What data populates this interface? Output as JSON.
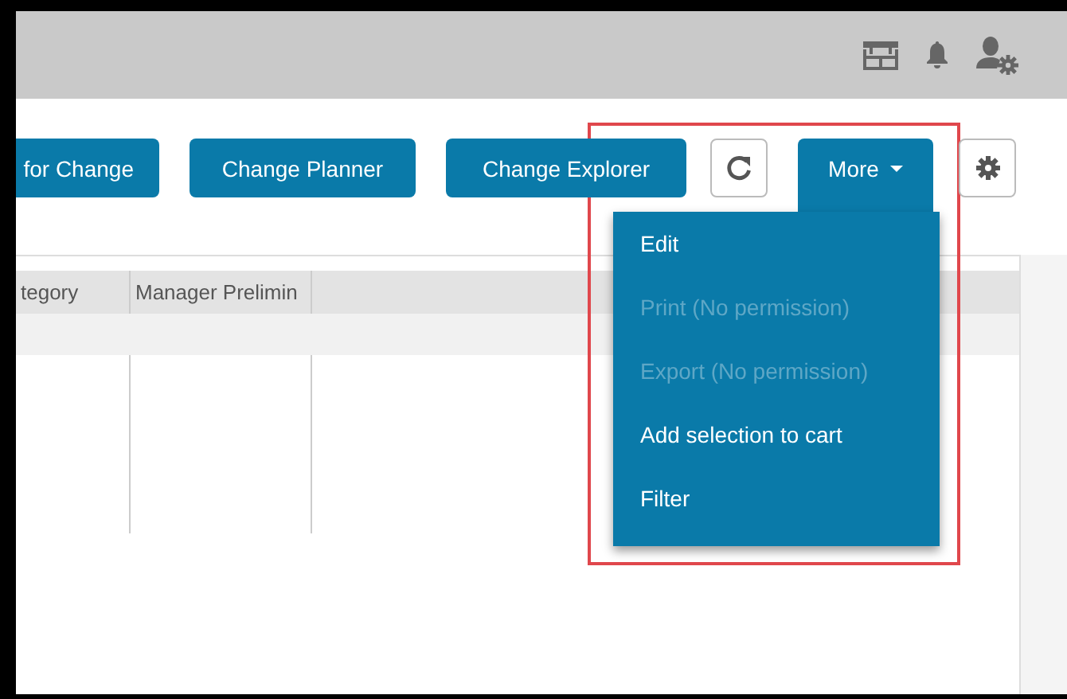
{
  "toolbar": {
    "buttons": [
      {
        "kind": "text",
        "label": "for Change"
      },
      {
        "kind": "text",
        "label": "Change Planner"
      },
      {
        "kind": "text",
        "label": "Change Explorer"
      },
      {
        "kind": "refresh"
      },
      {
        "kind": "dropdown",
        "label": "More",
        "expanded": true
      },
      {
        "kind": "settings"
      }
    ]
  },
  "menu": {
    "items": [
      {
        "label": "Edit",
        "disabled": false
      },
      {
        "label": "Print (No permission)",
        "disabled": true
      },
      {
        "label": "Export (No permission)",
        "disabled": true
      },
      {
        "label": "Add selection to cart",
        "disabled": false
      },
      {
        "label": "Filter",
        "disabled": false
      }
    ]
  },
  "table": {
    "columns": [
      "tegory",
      "Manager Prelimin"
    ]
  }
}
